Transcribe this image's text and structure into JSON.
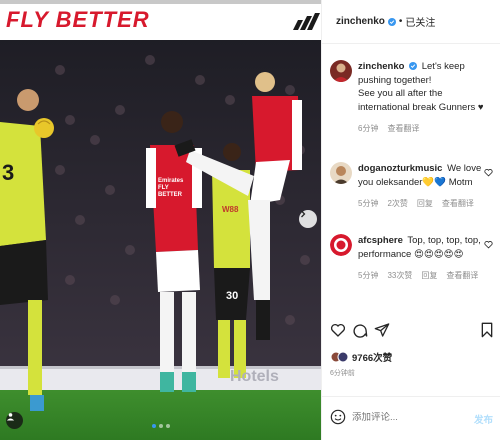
{
  "photo": {
    "banner_text": "FLY BETTER",
    "shirt_sponsor_home": "Emirates FLY BETTER",
    "shirt_sponsor_away": "W88",
    "shirt_number_away": "30",
    "shirt_number_left": "3",
    "board_text": "Hotels",
    "carousel_dots": 3,
    "active_dot": 0
  },
  "header": {
    "username": "zinchenko",
    "separator": "•",
    "follow_label": "已关注"
  },
  "caption": {
    "username": "zinchenko",
    "text": "Let's keep pushing together!\nSee you all after the international break Gunners ♥",
    "time": "6分钟",
    "translate": "查看翻译"
  },
  "comments": [
    {
      "username": "doganozturkmusic",
      "text": "We love you oleksander💛💙 Motm",
      "time": "5分钟",
      "likes": "2次赞",
      "reply": "回复",
      "translate": "查看翻译"
    },
    {
      "username": "afcsphere",
      "text": "Top, top, top, top, performance 😍😍😍😍😍",
      "time": "5分钟",
      "likes": "33次赞",
      "reply": "回复",
      "translate": "查看翻译"
    }
  ],
  "likes": {
    "count": "9766次赞"
  },
  "posted": {
    "time": "6分钟前"
  },
  "add_comment": {
    "placeholder": "添加评论...",
    "post_label": "发布"
  },
  "colors": {
    "accent": "#3897f0",
    "arsenal_red": "#d7192d",
    "away_yellow": "#d4e23c"
  }
}
